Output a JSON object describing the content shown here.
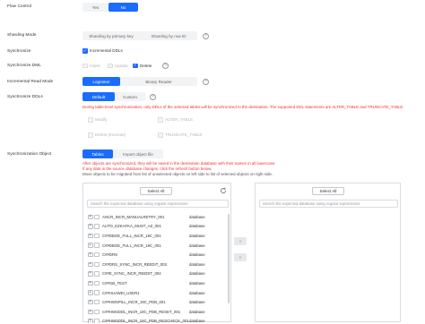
{
  "flow_control": {
    "label": "Flow Control",
    "options": [
      "Yes",
      "No"
    ],
    "selected": "No"
  },
  "sharding_mode": {
    "label": "Sharding Mode",
    "options": [
      "Sharding by primary key",
      "Sharding by row ID"
    ]
  },
  "synchronize": {
    "label": "Synchronize",
    "option": "Incremental DDLs",
    "checked": true
  },
  "synchronize_dml": {
    "label": "Synchronize DML",
    "options": [
      {
        "label": "Insert",
        "checked": false
      },
      {
        "label": "Update",
        "checked": false
      },
      {
        "label": "Delete",
        "checked": true
      }
    ]
  },
  "incremental_read_mode": {
    "label": "Incremental Read Mode",
    "options": [
      "Logminer",
      "Binary Reader"
    ],
    "selected": "Logminer"
  },
  "synchronize_ddls": {
    "label": "Synchronize DDLs",
    "options": [
      "Default",
      "Custom"
    ],
    "selected": "Default",
    "warning": "During table-level synchronization, only DDLs of the selected tables will be synchronized to the destination. The supported DDL statements are ALTER_TABLE and TRUNCATE_TABLE.",
    "ddl_options": [
      "Modify",
      "ALTER_TABLE",
      "Delete (truncate)",
      "TRUNCATE_TABLE"
    ]
  },
  "synchronization_object": {
    "label": "Synchronization Object",
    "tabs": [
      "Tables",
      "Import object file"
    ],
    "selected_tab": "Tables",
    "warning_line1": "After objects are synchronized, they will be saved in the destination database with their names in all lowercase.",
    "warning_line2": "If any data in the source database changes, click the refresh button below.",
    "note": "Move objects to be migrated from list of unselected objects on left side to list of selected objects on right side."
  },
  "left_panel": {
    "select_all": "Select All",
    "search_placeholder": "Search the expected database using regular expressions",
    "rows": [
      {
        "name": "ANCR_INCR_MANUALRETRY_001",
        "type": "database"
      },
      {
        "name": "AUTO_EZKAFKA_MUST_AZ_001",
        "type": "database"
      },
      {
        "name": "C##DBOE_FULL_INCR_19C_001",
        "type": "database"
      },
      {
        "name": "C##DBOE_FULL_INCR_19C_001",
        "type": "database"
      },
      {
        "name": "C##DRS",
        "type": "database"
      },
      {
        "name": "C##DRS_SYNC_INCR_REEDIT_003",
        "type": "database"
      },
      {
        "name": "C##E_SYNC_INCR_REEDIT_004",
        "type": "database"
      },
      {
        "name": "C##GB_TEST",
        "type": "database"
      },
      {
        "name": "C##HUAWEI_USER1",
        "type": "database"
      },
      {
        "name": "C##HWSPILL_INCR_19C_PDB_001",
        "type": "database"
      },
      {
        "name": "C##HWSDDL_INCR_19C_PDB_RESET_001",
        "type": "database"
      },
      {
        "name": "C##HWSDDL_INCR_19C_PDB_RESCHECK_001",
        "type": "database"
      }
    ]
  },
  "right_panel": {
    "select_all": "Select All",
    "search_placeholder": "Search the expected database using regular expressions"
  },
  "icons": {
    "help": "question-circle-icon",
    "refresh": "refresh-icon",
    "move_right": "double-chevron-right-icon",
    "move_left": "double-chevron-left-icon"
  },
  "colors": {
    "accent": "#1a6cff",
    "warning": "#f23030"
  }
}
